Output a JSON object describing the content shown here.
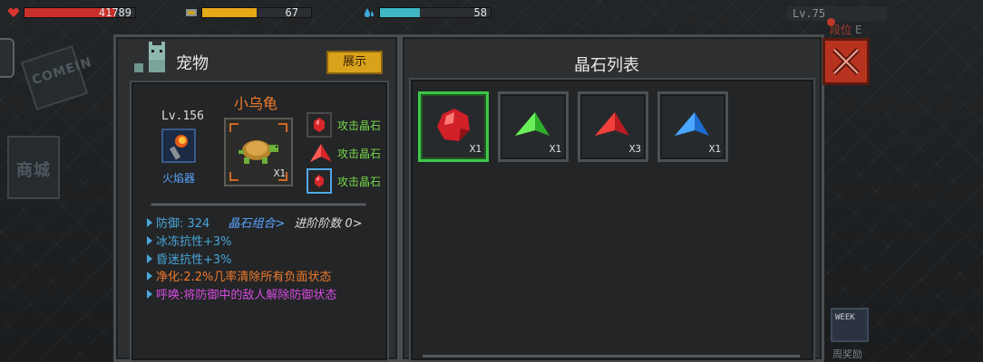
{
  "hud": {
    "hp_value": "41789",
    "hp_fill": 0.82,
    "energy_value": "67",
    "energy_fill": 0.5,
    "mana_value": "58",
    "mana_fill": 0.36,
    "level": "Lv.75",
    "rank_prefix": "段位",
    "rank_value": "E",
    "colors": {
      "hp": "#c9302c",
      "energy": "#e6a817",
      "mana": "#3fb7c4"
    }
  },
  "background": {
    "sign_text": "COMEIN",
    "sign2_text": "商城"
  },
  "pet_panel": {
    "title": "宠物",
    "show_button": "展示",
    "level": "Lv.156",
    "weapon_name": "火焰器",
    "pet_name": "小乌龟",
    "pet_qty": "X1",
    "gem_slots": [
      {
        "label": "攻击晶石",
        "icon": "red-crystal-icon"
      },
      {
        "label": "攻击晶石",
        "icon": "red-shard-icon"
      },
      {
        "label": "攻击晶石",
        "icon": "red-crystal-icon"
      }
    ],
    "stats": {
      "defense": "防御: 324",
      "gem_combo": "晶石组合>",
      "advance": "进阶阶数 0>",
      "freeze": "冰冻抗性+3%",
      "stun": "昏迷抗性+3%",
      "purify": "净化:2.2%几率清除所有负面状态",
      "summon": "呼唤:将防御中的敌人解除防御状态"
    },
    "colors": {
      "pet_name": "#f07a2a",
      "purify": "#f07a2a",
      "summon": "#d84be0",
      "gem_combo": "#5ca4ff",
      "gem_label": "#79d64a"
    }
  },
  "crystal_panel": {
    "title": "晶石列表",
    "crystals": [
      {
        "icon": "red-crystal-icon",
        "qty": "X1",
        "color": "#e02a2a"
      },
      {
        "icon": "green-shard-icon",
        "qty": "X1",
        "color": "#3ed23a"
      },
      {
        "icon": "red-shard-icon",
        "qty": "X3",
        "color": "#e02a2a"
      },
      {
        "icon": "blue-shard-icon",
        "qty": "X1",
        "color": "#3a8ef0"
      }
    ]
  },
  "side": {
    "weekly_reward": "周奖励",
    "weekly_icon_text": "WEEK"
  }
}
